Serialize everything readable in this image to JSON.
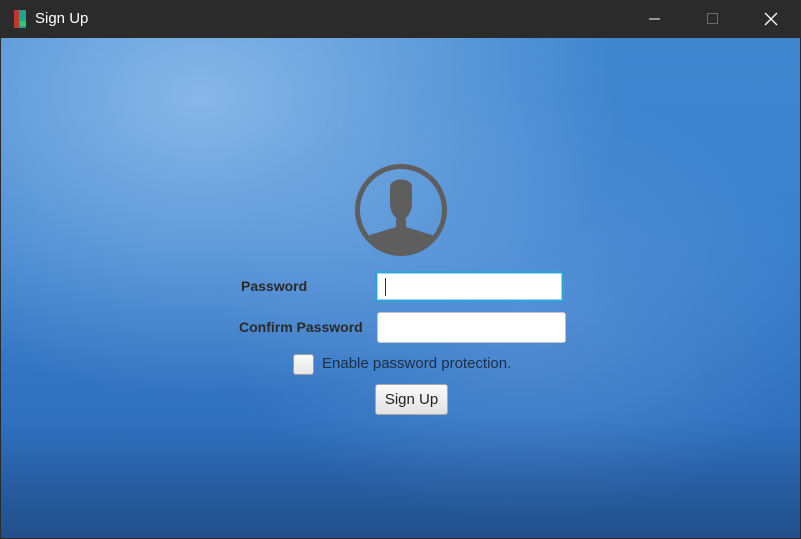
{
  "window": {
    "title": "Sign Up",
    "app_icon": "app-icon",
    "controls": {
      "minimize_icon": "minimize-icon",
      "maximize_icon": "maximize-icon",
      "close_icon": "close-icon"
    }
  },
  "form": {
    "avatar_icon": "user-avatar-icon",
    "password_label": "Password",
    "password_value": "",
    "confirm_label": "Confirm Password",
    "confirm_value": "",
    "protection_checkbox": {
      "label": "Enable password protection.",
      "checked": false
    },
    "signup_button_label": "Sign Up"
  },
  "colors": {
    "titlebar": "#2b2b2b",
    "background_blue": "#3a80cc",
    "focus_border": "#31a3d8",
    "avatar_gray": "#5e5e5e"
  }
}
